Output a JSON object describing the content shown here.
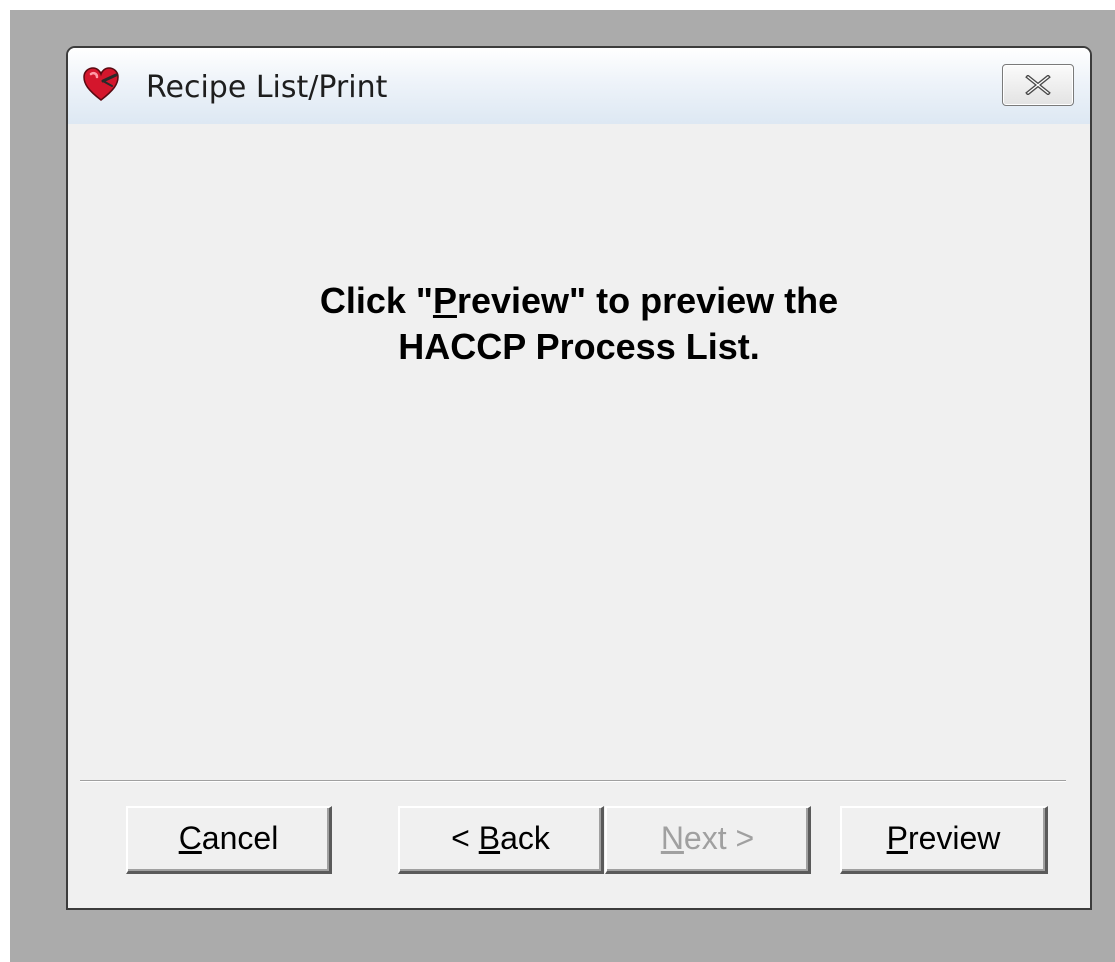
{
  "window": {
    "title": "Recipe List/Print",
    "app_icon": "heart-icon",
    "close_icon": "close-icon"
  },
  "message": {
    "line1_prefix": "Click \"",
    "line1_mnemonic": "P",
    "line1_rest": "review\" to preview the",
    "line2": "HACCP Process List."
  },
  "buttons": {
    "cancel": {
      "mnemonic": "C",
      "rest": "ancel",
      "enabled": true
    },
    "back": {
      "prefix": "< ",
      "mnemonic": "B",
      "rest": "ack",
      "enabled": true
    },
    "next": {
      "mnemonic": "N",
      "rest": "ext >",
      "enabled": false
    },
    "preview": {
      "mnemonic": "P",
      "rest": "review",
      "enabled": true
    }
  },
  "colors": {
    "backdrop": "#ababab",
    "dialog_background": "#f0f0f0",
    "title_gradient_top": "#ffffff",
    "title_gradient_bottom": "#dde8f3",
    "disabled_text": "#a0a0a0",
    "icon_red": "#d4162c"
  }
}
